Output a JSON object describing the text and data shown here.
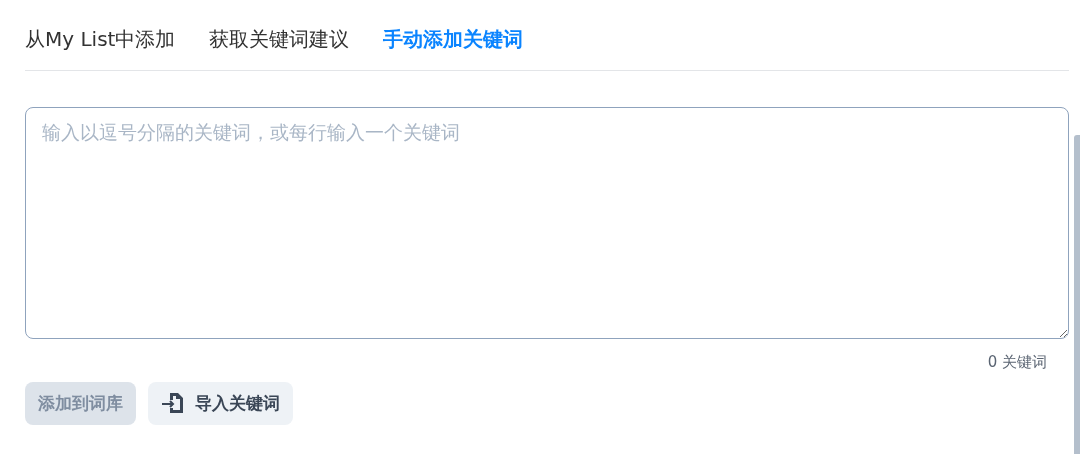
{
  "tabs": [
    {
      "label": "从My List中添加",
      "selected": false
    },
    {
      "label": "获取关键词建议",
      "selected": false
    },
    {
      "label": "手动添加关键词",
      "selected": true
    }
  ],
  "keyword_input": {
    "placeholder": "输入以逗号分隔的关键词，或每行输入一个关键词"
  },
  "keyword_count": "0 关键词",
  "buttons": [
    {
      "label": "添加到词库",
      "kind": "plain",
      "disabled": true
    },
    {
      "label": "导入关键词",
      "kind": "import",
      "disabled": false
    }
  ]
}
